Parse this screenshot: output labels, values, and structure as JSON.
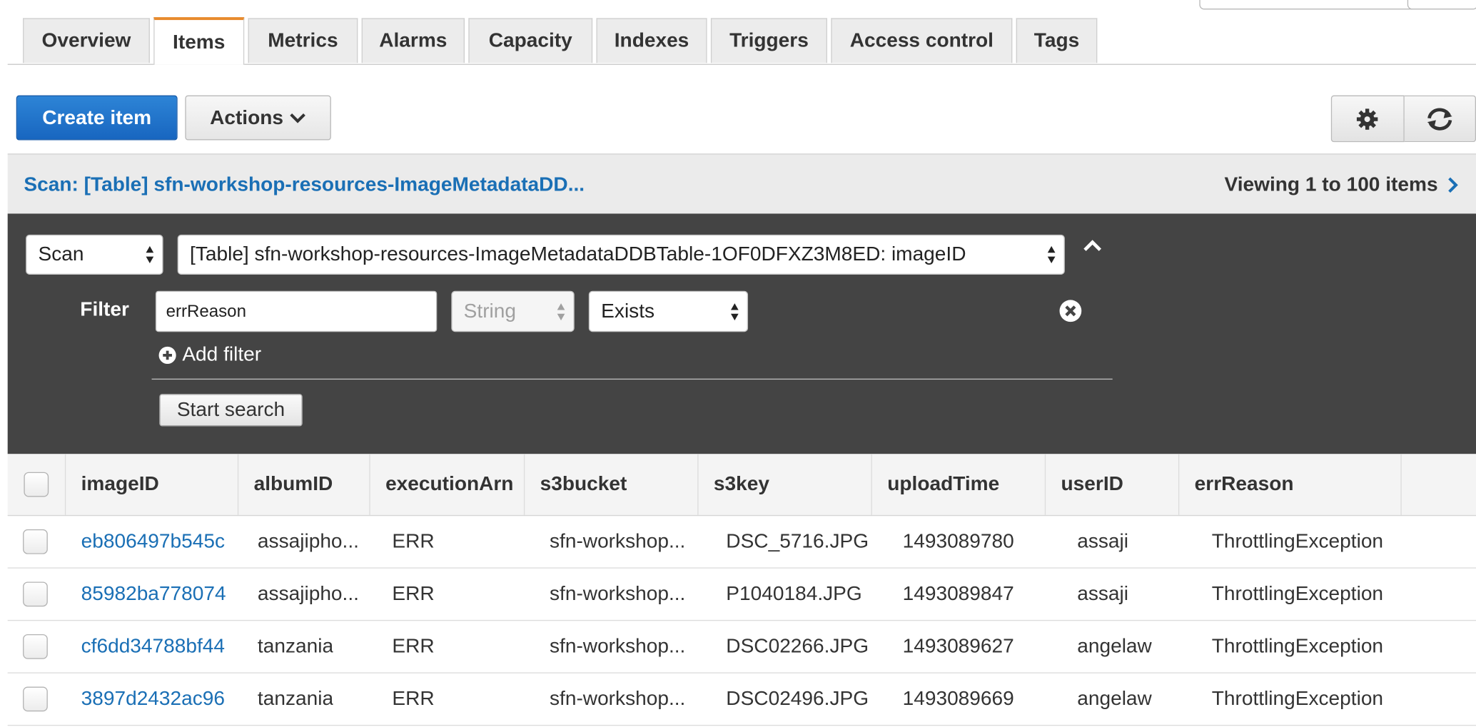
{
  "tabs": [
    "Overview",
    "Items",
    "Metrics",
    "Alarms",
    "Capacity",
    "Indexes",
    "Triggers",
    "Access control",
    "Tags"
  ],
  "active_tab": "Items",
  "toolbar": {
    "create_label": "Create item",
    "actions_label": "Actions",
    "settings_icon": "gear-icon",
    "refresh_icon": "refresh-icon"
  },
  "scan_bar": {
    "title": "Scan: [Table] sfn-workshop-resources-ImageMetadataDD...",
    "viewing": "Viewing 1 to 100 items"
  },
  "query": {
    "mode": "Scan",
    "table": "[Table] sfn-workshop-resources-ImageMetadataDDBTable-1OF0DFXZ3M8ED: imageID",
    "filter_label": "Filter",
    "filter_attr": "errReason",
    "filter_type": "String",
    "filter_condition": "Exists",
    "add_filter": "Add filter",
    "start_search": "Start search"
  },
  "table": {
    "columns": [
      "imageID",
      "albumID",
      "executionArn",
      "s3bucket",
      "s3key",
      "uploadTime",
      "userID",
      "errReason"
    ],
    "rows": [
      [
        "eb806497b545c",
        "assajipho...",
        "ERR",
        "sfn-workshop...",
        "DSC_5716.JPG",
        "1493089780",
        "assaji",
        "ThrottlingException"
      ],
      [
        "85982ba778074",
        "assajipho...",
        "ERR",
        "sfn-workshop...",
        "P1040184.JPG",
        "1493089847",
        "assaji",
        "ThrottlingException"
      ],
      [
        "cf6dd34788bf44",
        "tanzania",
        "ERR",
        "sfn-workshop...",
        "DSC02266.JPG",
        "1493089627",
        "angelaw",
        "ThrottlingException"
      ],
      [
        "3897d2432ac96",
        "tanzania",
        "ERR",
        "sfn-workshop...",
        "DSC02496.JPG",
        "1493089669",
        "angelaw",
        "ThrottlingException"
      ]
    ]
  },
  "colors": {
    "primary": "#1866c0",
    "link": "#1a6fb5",
    "tab_accent": "#e88b2e",
    "panel_dark": "#444444"
  }
}
